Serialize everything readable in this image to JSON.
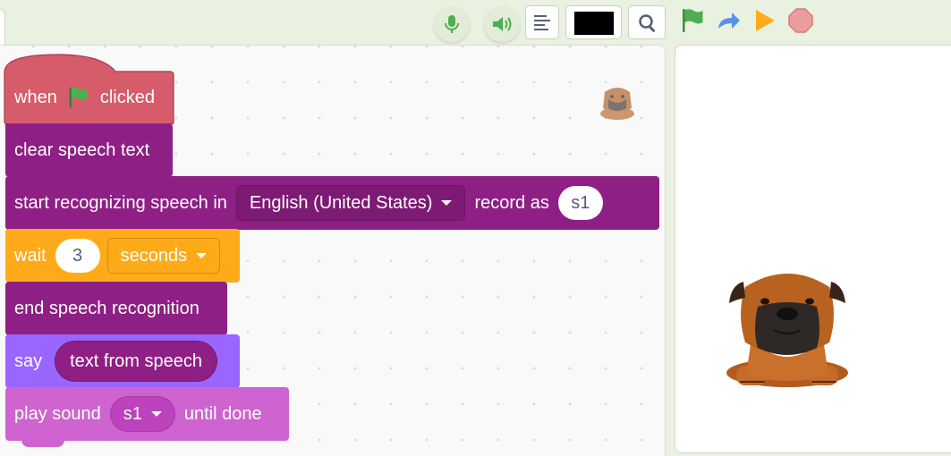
{
  "toolbar": {
    "icons": [
      "microphone-icon",
      "speaker-icon",
      "list-icon",
      "color-swatch",
      "search-icon"
    ],
    "swatch_color": "#000000",
    "green_flag_color": "#4caf50",
    "turbo_color": "#5b8ee6",
    "run_color": "#ffab19",
    "stop_color": "#ec9c9c"
  },
  "colors": {
    "event": "#d65c6b",
    "extension": "#8e1f84",
    "control": "#ffab19",
    "looks": "#9966ff",
    "sound": "#cf63cf"
  },
  "script": {
    "hat": {
      "when": "when",
      "clicked": "clicked"
    },
    "clear": {
      "label": "clear speech text"
    },
    "start": {
      "label": "start recognizing speech in",
      "language": "English (United States)",
      "record_label": "record as",
      "record_value": "s1"
    },
    "wait": {
      "label": "wait",
      "value": "3",
      "unit": "seconds"
    },
    "end": {
      "label": "end speech recognition"
    },
    "say": {
      "label": "say",
      "reporter": "text from speech"
    },
    "play": {
      "label": "play sound",
      "sound": "s1",
      "suffix": "until done"
    }
  }
}
